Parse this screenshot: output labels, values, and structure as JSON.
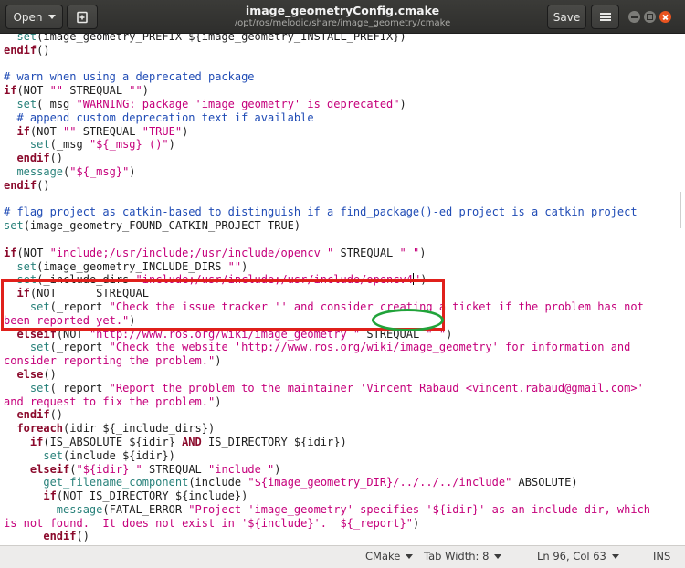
{
  "header": {
    "open_label": "Open",
    "title": "image_geometryConfig.cmake",
    "path": "/opt/ros/melodic/share/image_geometry/cmake",
    "save_label": "Save",
    "new_tab_icon": "new-document-icon",
    "menu_icon": "hamburger-menu-icon"
  },
  "code_lines": [
    [
      [
        "  ",
        ""
      ],
      [
        "set",
        "f"
      ],
      [
        "(image_geometry_PREFIX ${image_geometry_INSTALL_PREFIX})",
        ""
      ]
    ],
    [
      [
        "endif",
        "k"
      ],
      [
        "()",
        ""
      ]
    ],
    [
      [
        "",
        ""
      ]
    ],
    [
      [
        "# warn when using a deprecated package",
        "c"
      ]
    ],
    [
      [
        "if",
        "k"
      ],
      [
        "(NOT ",
        ""
      ],
      [
        "\"\"",
        "s"
      ],
      [
        " STREQUAL ",
        ""
      ],
      [
        "\"\"",
        "s"
      ],
      [
        ")",
        ""
      ]
    ],
    [
      [
        "  ",
        ""
      ],
      [
        "set",
        "f"
      ],
      [
        "(_msg ",
        ""
      ],
      [
        "\"WARNING: package 'image_geometry' is deprecated\"",
        "s"
      ],
      [
        ")",
        ""
      ]
    ],
    [
      [
        "  ",
        ""
      ],
      [
        "# append custom deprecation text if available",
        "c"
      ]
    ],
    [
      [
        "  ",
        ""
      ],
      [
        "if",
        "k"
      ],
      [
        "(NOT ",
        ""
      ],
      [
        "\"\"",
        "s"
      ],
      [
        " STREQUAL ",
        ""
      ],
      [
        "\"TRUE\"",
        "s"
      ],
      [
        ")",
        ""
      ]
    ],
    [
      [
        "    ",
        ""
      ],
      [
        "set",
        "f"
      ],
      [
        "(_msg ",
        ""
      ],
      [
        "\"${_msg} ()\"",
        "s"
      ],
      [
        ")",
        ""
      ]
    ],
    [
      [
        "  ",
        ""
      ],
      [
        "endif",
        "k"
      ],
      [
        "()",
        ""
      ]
    ],
    [
      [
        "  ",
        ""
      ],
      [
        "message",
        "f"
      ],
      [
        "(",
        ""
      ],
      [
        "\"${_msg}\"",
        "s"
      ],
      [
        ")",
        ""
      ]
    ],
    [
      [
        "endif",
        "k"
      ],
      [
        "()",
        ""
      ]
    ],
    [
      [
        "",
        ""
      ]
    ],
    [
      [
        "# flag project as catkin-based to distinguish if a find_package()-ed project is a catkin project",
        "c"
      ]
    ],
    [
      [
        "set",
        "f"
      ],
      [
        "(image_geometry_FOUND_CATKIN_PROJECT TRUE)",
        ""
      ]
    ],
    [
      [
        "",
        ""
      ]
    ],
    [
      [
        "if",
        "k"
      ],
      [
        "(NOT ",
        ""
      ],
      [
        "\"include;/usr/include;/usr/include/opencv \"",
        "s"
      ],
      [
        " STREQUAL ",
        ""
      ],
      [
        "\" \"",
        "s"
      ],
      [
        ")",
        ""
      ]
    ],
    [
      [
        "  ",
        ""
      ],
      [
        "set",
        "f"
      ],
      [
        "(image_geometry_INCLUDE_DIRS ",
        ""
      ],
      [
        "\"\"",
        "s"
      ],
      [
        ")",
        ""
      ]
    ],
    [
      [
        "  ",
        ""
      ],
      [
        "set",
        "f"
      ],
      [
        "(_include_dirs ",
        ""
      ],
      [
        "\"include;/usr/include;/usr/include/opencv4",
        "s"
      ],
      [
        "|cursor",
        ""
      ],
      [
        "\"",
        "s"
      ],
      [
        ")",
        ""
      ]
    ],
    [
      [
        "  ",
        ""
      ],
      [
        "if",
        "k"
      ],
      [
        "(NOT      STREQUAL   ",
        ""
      ]
    ],
    [
      [
        "    ",
        ""
      ],
      [
        "set",
        "f"
      ],
      [
        "(_report ",
        ""
      ],
      [
        "\"Check the issue tracker '' and consider creating a ticket if the problem has not",
        "s"
      ]
    ],
    [
      [
        "been reported yet.\"",
        "s"
      ],
      [
        ")",
        ""
      ]
    ],
    [
      [
        "  ",
        ""
      ],
      [
        "elseif",
        "k"
      ],
      [
        "(NOT ",
        ""
      ],
      [
        "\"http://www.ros.org/wiki/image_geometry \"",
        "s"
      ],
      [
        " STREQUAL ",
        ""
      ],
      [
        "\" \"",
        "s"
      ],
      [
        ")",
        ""
      ]
    ],
    [
      [
        "    ",
        ""
      ],
      [
        "set",
        "f"
      ],
      [
        "(_report ",
        ""
      ],
      [
        "\"Check the website 'http://www.ros.org/wiki/image_geometry' for information and",
        "s"
      ]
    ],
    [
      [
        "consider reporting the problem.\"",
        "s"
      ],
      [
        ")",
        ""
      ]
    ],
    [
      [
        "  ",
        ""
      ],
      [
        "else",
        "k"
      ],
      [
        "()",
        ""
      ]
    ],
    [
      [
        "    ",
        ""
      ],
      [
        "set",
        "f"
      ],
      [
        "(_report ",
        ""
      ],
      [
        "\"Report the problem to the maintainer 'Vincent Rabaud <vincent.rabaud@gmail.com>'",
        "s"
      ]
    ],
    [
      [
        "and request to fix the problem.\"",
        "s"
      ],
      [
        ")",
        ""
      ]
    ],
    [
      [
        "  ",
        ""
      ],
      [
        "endif",
        "k"
      ],
      [
        "()",
        ""
      ]
    ],
    [
      [
        "  ",
        ""
      ],
      [
        "foreach",
        "k"
      ],
      [
        "(idir ${_include_dirs})",
        ""
      ]
    ],
    [
      [
        "    ",
        ""
      ],
      [
        "if",
        "k"
      ],
      [
        "(IS_ABSOLUTE ${idir} ",
        ""
      ],
      [
        "AND",
        "k"
      ],
      [
        " IS_DIRECTORY ${idir})",
        ""
      ]
    ],
    [
      [
        "      ",
        ""
      ],
      [
        "set",
        "f"
      ],
      [
        "(include ${idir})",
        ""
      ]
    ],
    [
      [
        "    ",
        ""
      ],
      [
        "elseif",
        "k"
      ],
      [
        "(",
        ""
      ],
      [
        "\"${idir} \"",
        "s"
      ],
      [
        " STREQUAL ",
        ""
      ],
      [
        "\"include \"",
        "s"
      ],
      [
        ")",
        ""
      ]
    ],
    [
      [
        "      ",
        ""
      ],
      [
        "get_filename_component",
        "f"
      ],
      [
        "(include ",
        ""
      ],
      [
        "\"${image_geometry_DIR}/../../../include\"",
        "s"
      ],
      [
        " ABSOLUTE)",
        ""
      ]
    ],
    [
      [
        "      ",
        ""
      ],
      [
        "if",
        "k"
      ],
      [
        "(NOT IS_DIRECTORY ${include})",
        ""
      ]
    ],
    [
      [
        "        ",
        ""
      ],
      [
        "message",
        "f"
      ],
      [
        "(FATAL_ERROR ",
        ""
      ],
      [
        "\"Project 'image_geometry' specifies '${idir}' as an include dir, which",
        "s"
      ]
    ],
    [
      [
        "is not found.  It does not exist in '${include}'.  ${_report}\"",
        "s"
      ],
      [
        ")",
        ""
      ]
    ],
    [
      [
        "      ",
        ""
      ],
      [
        "endif",
        "k"
      ],
      [
        "()",
        ""
      ]
    ]
  ],
  "statusbar": {
    "language": "CMake",
    "tab_width": "Tab Width: 8",
    "cursor_position": "Ln 96, Col 63",
    "insert_mode": "INS"
  },
  "annotations": {
    "red_box": "highlight around if/set include_dirs block",
    "green_ellipse": "highlight around opencv4"
  }
}
